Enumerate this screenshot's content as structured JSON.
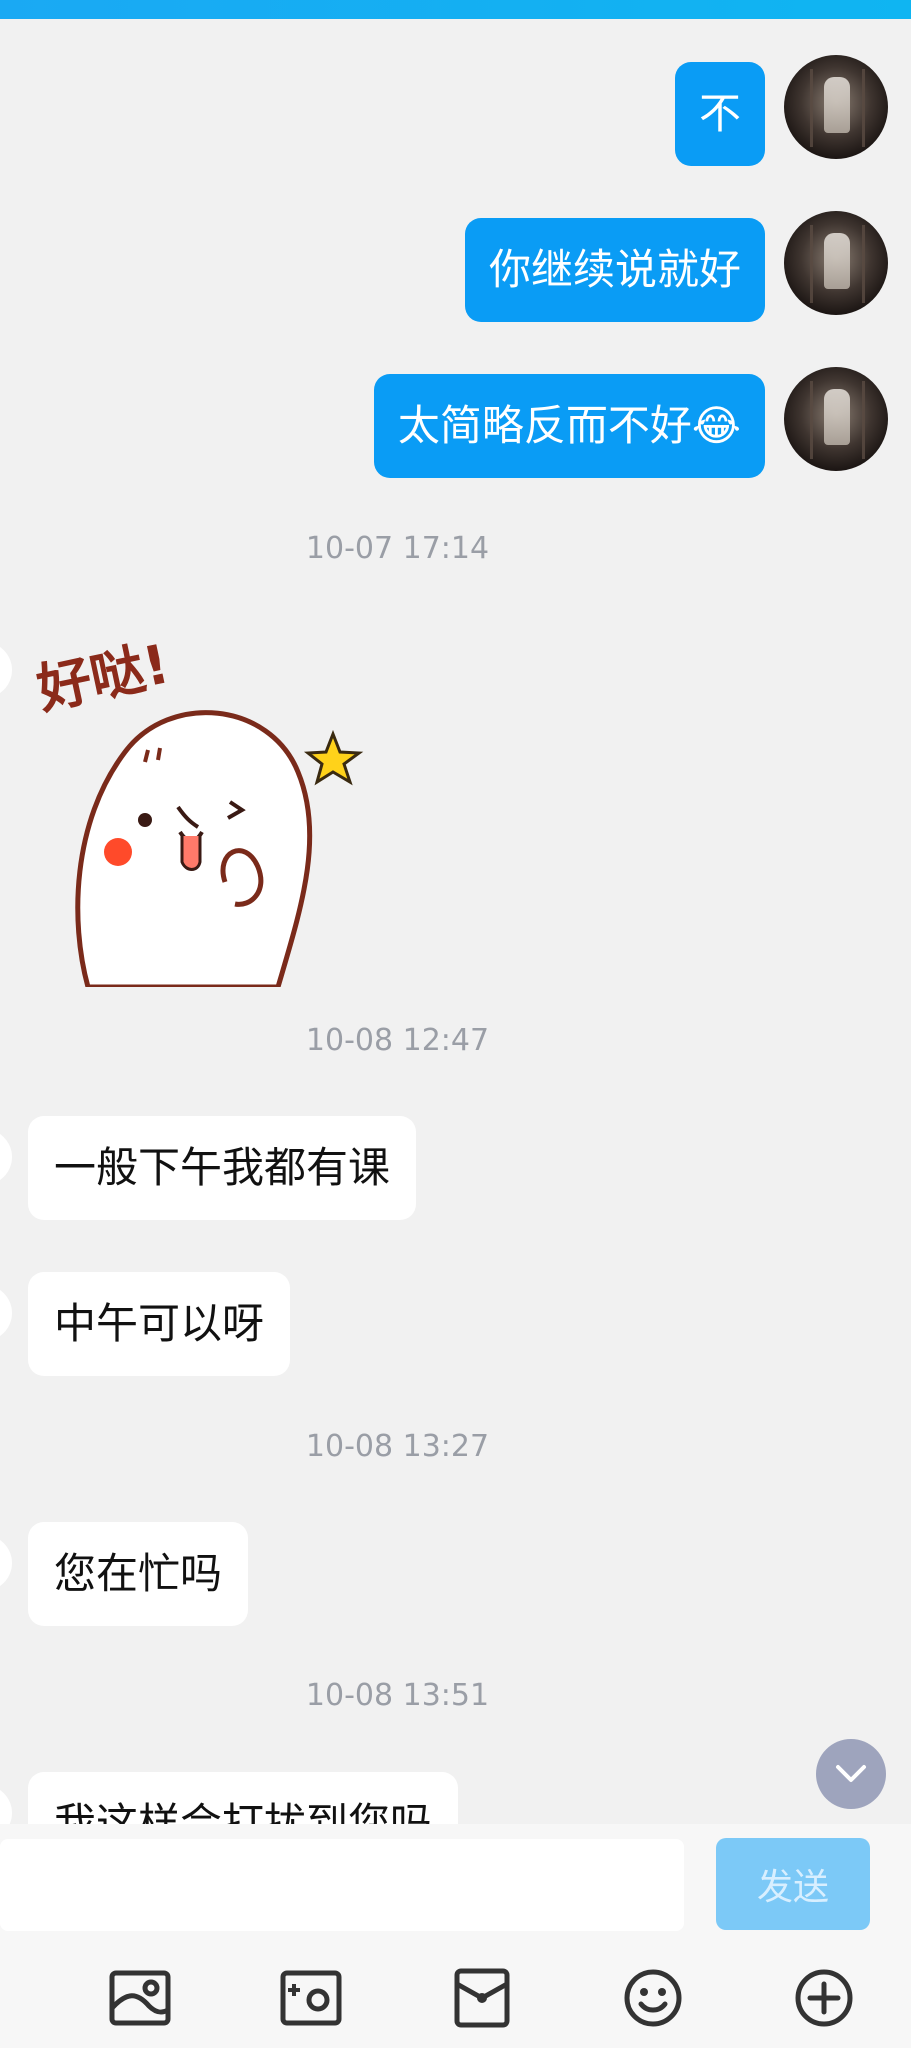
{
  "messages_out": [
    {
      "text": "不"
    },
    {
      "text": "你继续说就好"
    },
    {
      "text": "太简略反而不好😂"
    }
  ],
  "timestamps": [
    "10-07 17:14",
    "10-08 12:47",
    "10-08 13:27",
    "10-08 13:51"
  ],
  "sticker": {
    "text": "好哒!"
  },
  "messages_in": [
    {
      "text": "一般下午我都有课"
    },
    {
      "text": "中午可以呀"
    },
    {
      "text": "您在忙吗"
    },
    {
      "text": "我这样会打扰到您吗"
    }
  ],
  "composer": {
    "placeholder": "",
    "send_label": "发送"
  },
  "toolbar": {
    "icons": [
      "image-icon",
      "camera-icon",
      "red-packet-icon",
      "emoji-icon",
      "plus-icon"
    ]
  },
  "colors": {
    "accent": "#0a9cf5",
    "send_disabled": "#7cc9f7",
    "background": "#f1f1f1"
  }
}
